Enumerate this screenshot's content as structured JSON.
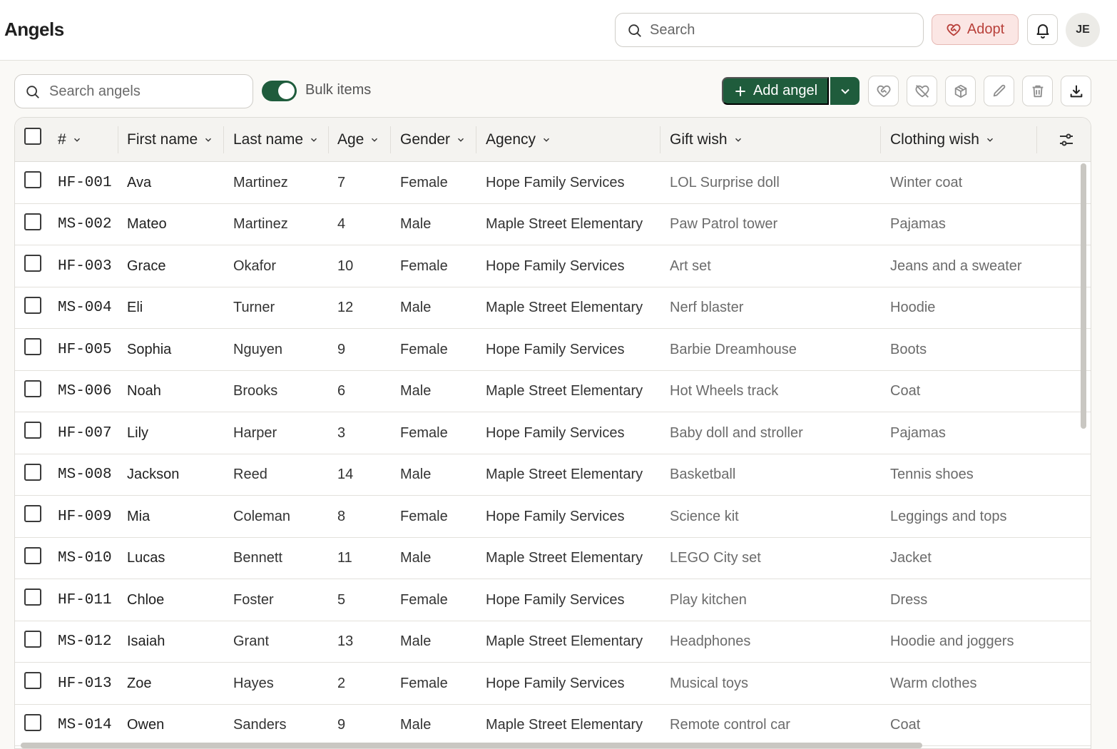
{
  "header": {
    "title": "Angels",
    "search_placeholder": "Search",
    "adopt_label": "Adopt",
    "avatar_initials": "JE"
  },
  "toolbar": {
    "search_placeholder": "Search angels",
    "bulk_label": "Bulk items",
    "bulk_enabled": true,
    "add_label": "Add angel",
    "icons": [
      "adopt-icon",
      "unadopt-icon",
      "package-icon",
      "edit-icon",
      "delete-icon",
      "download-icon"
    ]
  },
  "columns": [
    "#",
    "First name",
    "Last name",
    "Age",
    "Gender",
    "Agency",
    "Gift wish",
    "Clothing wish"
  ],
  "rows": [
    {
      "id": "HF-001",
      "first": "Ava",
      "last": "Martinez",
      "age": "7",
      "gender": "Female",
      "agency": "Hope Family Services",
      "gift": "LOL Surprise doll",
      "clothing": "Winter coat"
    },
    {
      "id": "MS-002",
      "first": "Mateo",
      "last": "Martinez",
      "age": "4",
      "gender": "Male",
      "agency": "Maple Street Elementary",
      "gift": "Paw Patrol tower",
      "clothing": "Pajamas"
    },
    {
      "id": "HF-003",
      "first": "Grace",
      "last": "Okafor",
      "age": "10",
      "gender": "Female",
      "agency": "Hope Family Services",
      "gift": "Art set",
      "clothing": "Jeans and a sweater"
    },
    {
      "id": "MS-004",
      "first": "Eli",
      "last": "Turner",
      "age": "12",
      "gender": "Male",
      "agency": "Maple Street Elementary",
      "gift": "Nerf blaster",
      "clothing": "Hoodie"
    },
    {
      "id": "HF-005",
      "first": "Sophia",
      "last": "Nguyen",
      "age": "9",
      "gender": "Female",
      "agency": "Hope Family Services",
      "gift": "Barbie Dreamhouse",
      "clothing": "Boots"
    },
    {
      "id": "MS-006",
      "first": "Noah",
      "last": "Brooks",
      "age": "6",
      "gender": "Male",
      "agency": "Maple Street Elementary",
      "gift": "Hot Wheels track",
      "clothing": "Coat"
    },
    {
      "id": "HF-007",
      "first": "Lily",
      "last": "Harper",
      "age": "3",
      "gender": "Female",
      "agency": "Hope Family Services",
      "gift": "Baby doll and stroller",
      "clothing": "Pajamas"
    },
    {
      "id": "MS-008",
      "first": "Jackson",
      "last": "Reed",
      "age": "14",
      "gender": "Male",
      "agency": "Maple Street Elementary",
      "gift": "Basketball",
      "clothing": "Tennis shoes"
    },
    {
      "id": "HF-009",
      "first": "Mia",
      "last": "Coleman",
      "age": "8",
      "gender": "Female",
      "agency": "Hope Family Services",
      "gift": "Science kit",
      "clothing": "Leggings and tops"
    },
    {
      "id": "MS-010",
      "first": "Lucas",
      "last": "Bennett",
      "age": "11",
      "gender": "Male",
      "agency": "Maple Street Elementary",
      "gift": "LEGO City set",
      "clothing": "Jacket"
    },
    {
      "id": "HF-011",
      "first": "Chloe",
      "last": "Foster",
      "age": "5",
      "gender": "Female",
      "agency": "Hope Family Services",
      "gift": "Play kitchen",
      "clothing": "Dress"
    },
    {
      "id": "MS-012",
      "first": "Isaiah",
      "last": "Grant",
      "age": "13",
      "gender": "Male",
      "agency": "Maple Street Elementary",
      "gift": "Headphones",
      "clothing": "Hoodie and joggers"
    },
    {
      "id": "HF-013",
      "first": "Zoe",
      "last": "Hayes",
      "age": "2",
      "gender": "Female",
      "agency": "Hope Family Services",
      "gift": "Musical toys",
      "clothing": "Warm clothes"
    },
    {
      "id": "MS-014",
      "first": "Owen",
      "last": "Sanders",
      "age": "9",
      "gender": "Male",
      "agency": "Maple Street Elementary",
      "gift": "Remote control car",
      "clothing": "Coat"
    }
  ],
  "colors": {
    "accent": "#1f5c3c",
    "adopt_bg": "#fbe6e4",
    "adopt_text": "#b8403a"
  }
}
